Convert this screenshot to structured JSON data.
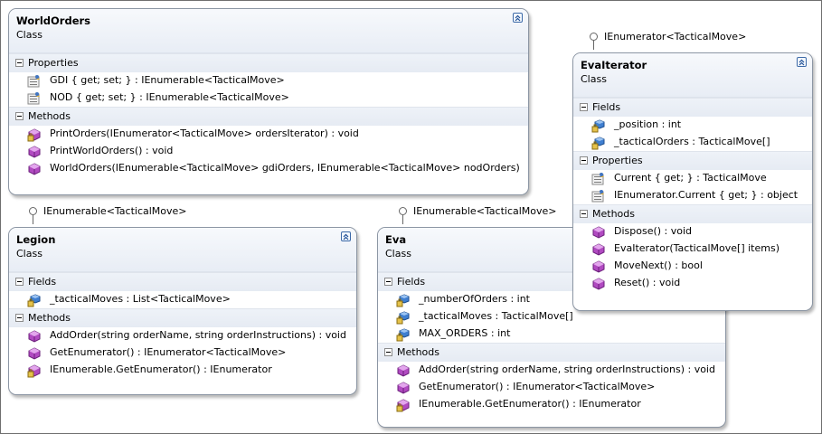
{
  "classes": [
    {
      "name": "WorldOrders",
      "kind": "Class",
      "sections": [
        {
          "label": "Properties",
          "members": [
            {
              "icon": "property-icon",
              "text": "GDI { get; set; } : IEnumerable<TacticalMove>"
            },
            {
              "icon": "property-icon",
              "text": "NOD { get; set; } : IEnumerable<TacticalMove>"
            }
          ]
        },
        {
          "label": "Methods",
          "members": [
            {
              "icon": "private-method-icon",
              "text": "PrintOrders(IEnumerator<TacticalMove> ordersIterator) : void"
            },
            {
              "icon": "method-icon",
              "text": "PrintWorldOrders() : void"
            },
            {
              "icon": "method-icon",
              "text": "WorldOrders(IEnumerable<TacticalMove>  gdiOrders,  IEnumerable<TacticalMove>  nodOrders)"
            }
          ]
        }
      ]
    },
    {
      "name": "EvaIterator",
      "kind": "Class",
      "interface": "IEnumerator<TacticalMove>",
      "sections": [
        {
          "label": "Fields",
          "members": [
            {
              "icon": "private-field-icon",
              "text": "_position : int"
            },
            {
              "icon": "private-field-icon",
              "text": "_tacticalOrders : TacticalMove[]"
            }
          ]
        },
        {
          "label": "Properties",
          "members": [
            {
              "icon": "property-icon",
              "text": "Current { get; } : TacticalMove"
            },
            {
              "icon": "property-icon",
              "text": "IEnumerator.Current { get; } : object"
            }
          ]
        },
        {
          "label": "Methods",
          "members": [
            {
              "icon": "method-icon",
              "text": "Dispose() : void"
            },
            {
              "icon": "method-icon",
              "text": "EvaIterator(TacticalMove[] items)"
            },
            {
              "icon": "method-icon",
              "text": "MoveNext() : bool"
            },
            {
              "icon": "method-icon",
              "text": "Reset() : void"
            }
          ]
        }
      ]
    },
    {
      "name": "Legion",
      "kind": "Class",
      "interface": "IEnumerable<TacticalMove>",
      "sections": [
        {
          "label": "Fields",
          "members": [
            {
              "icon": "private-field-icon",
              "text": "_tacticalMoves : List<TacticalMove>"
            }
          ]
        },
        {
          "label": "Methods",
          "members": [
            {
              "icon": "method-icon",
              "text": "AddOrder(string orderName, string orderInstructions) : void"
            },
            {
              "icon": "method-icon",
              "text": "GetEnumerator() : IEnumerator<TacticalMove>"
            },
            {
              "icon": "private-method-icon",
              "text": "IEnumerable.GetEnumerator() : IEnumerator"
            }
          ]
        }
      ]
    },
    {
      "name": "Eva",
      "kind": "Class",
      "interface": "IEnumerable<TacticalMove>",
      "sections": [
        {
          "label": "Fields",
          "members": [
            {
              "icon": "private-field-icon",
              "text": "_numberOfOrders : int"
            },
            {
              "icon": "private-field-icon",
              "text": "_tacticalMoves : TacticalMove[]"
            },
            {
              "icon": "private-field-icon",
              "text": "MAX_ORDERS : int"
            }
          ]
        },
        {
          "label": "Methods",
          "members": [
            {
              "icon": "method-icon",
              "text": "AddOrder(string orderName, string orderInstructions) : void"
            },
            {
              "icon": "method-icon",
              "text": "GetEnumerator() : IEnumerator<TacticalMove>"
            },
            {
              "icon": "private-method-icon",
              "text": "IEnumerable.GetEnumerator() : IEnumerator"
            }
          ]
        }
      ]
    }
  ]
}
